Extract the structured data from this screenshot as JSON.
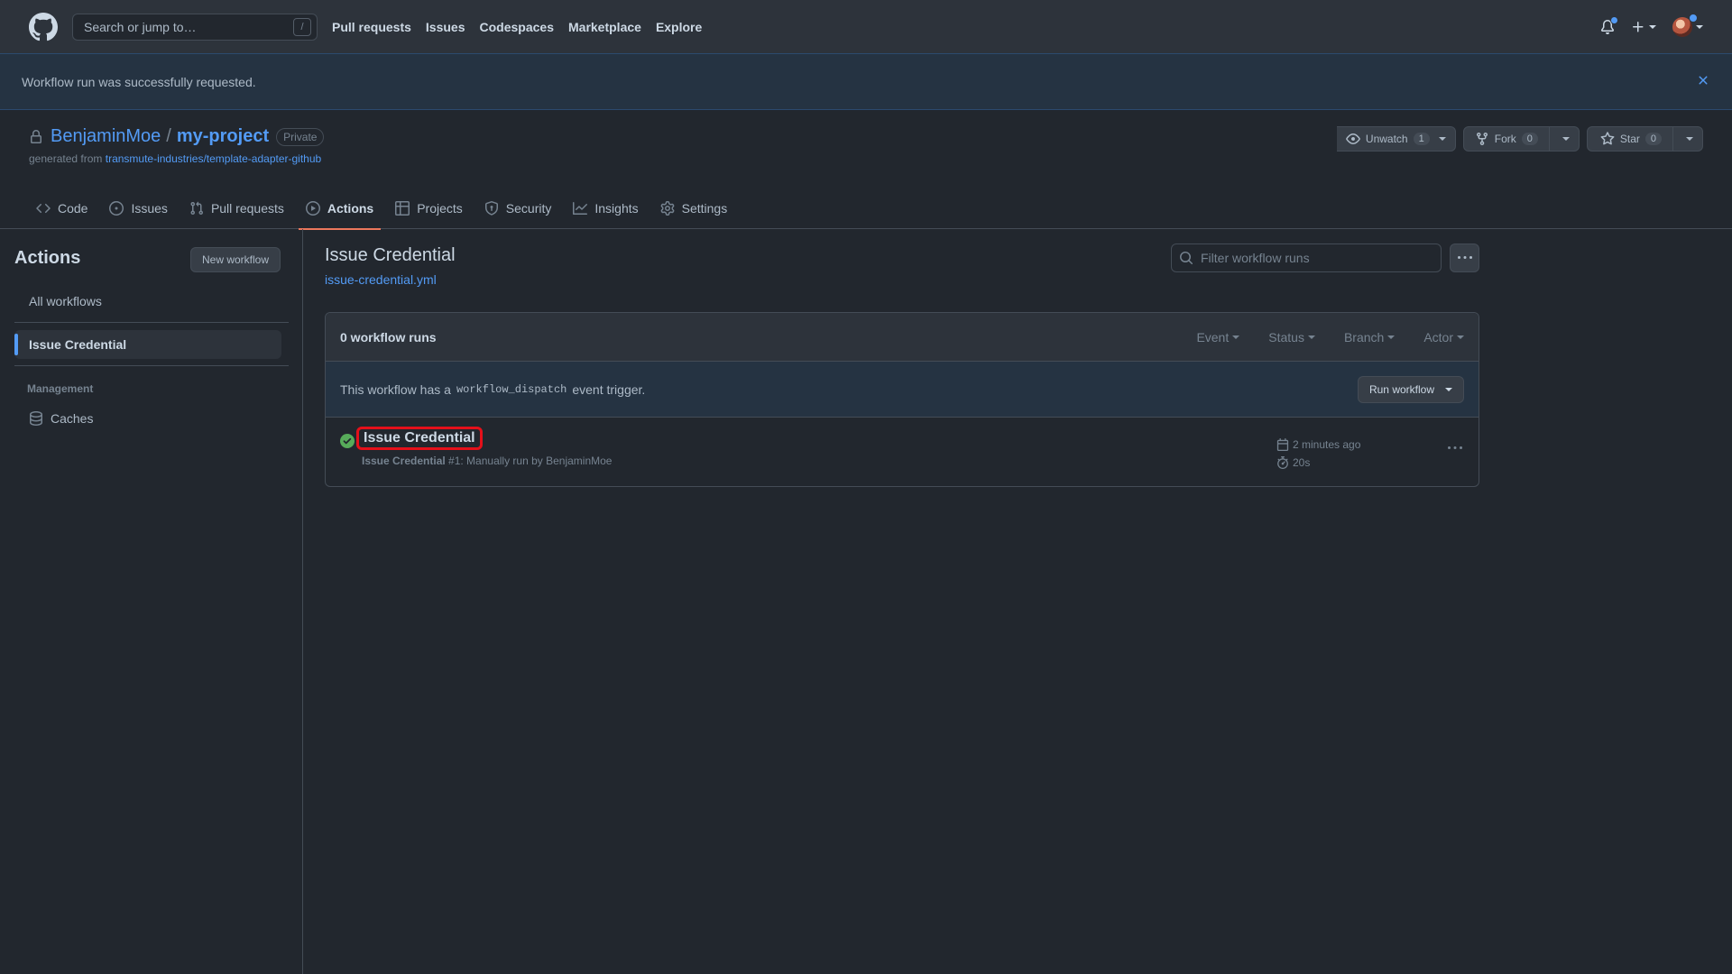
{
  "header": {
    "search_placeholder": "Search or jump to…",
    "search_key": "/",
    "nav": [
      "Pull requests",
      "Issues",
      "Codespaces",
      "Marketplace",
      "Explore"
    ]
  },
  "flash": {
    "message": "Workflow run was successfully requested."
  },
  "repo": {
    "owner": "BenjaminMoe",
    "separator": "/",
    "name": "my-project",
    "visibility": "Private",
    "generated_prefix": "generated from",
    "generated_link": "transmute-industries/template-adapter-github",
    "unwatch_label": "Unwatch",
    "unwatch_count": "1",
    "fork_label": "Fork",
    "fork_count": "0",
    "star_label": "Star",
    "star_count": "0"
  },
  "tabs": [
    {
      "label": "Code",
      "icon": "code-icon"
    },
    {
      "label": "Issues",
      "icon": "issue-icon"
    },
    {
      "label": "Pull requests",
      "icon": "pull-request-icon"
    },
    {
      "label": "Actions",
      "icon": "play-icon",
      "selected": true
    },
    {
      "label": "Projects",
      "icon": "table-icon"
    },
    {
      "label": "Security",
      "icon": "shield-icon"
    },
    {
      "label": "Insights",
      "icon": "graph-icon"
    },
    {
      "label": "Settings",
      "icon": "gear-icon"
    }
  ],
  "sidebar": {
    "title": "Actions",
    "new_workflow": "New workflow",
    "all_workflows": "All workflows",
    "selected_workflow": "Issue Credential",
    "management_heading": "Management",
    "caches": "Caches"
  },
  "main": {
    "title": "Issue Credential",
    "file": "issue-credential.yml",
    "filter_placeholder": "Filter workflow runs",
    "runs_count": "0 workflow runs",
    "filters": [
      "Event",
      "Status",
      "Branch",
      "Actor"
    ],
    "dispatch_prefix": "This workflow has a",
    "dispatch_code": "workflow_dispatch",
    "dispatch_suffix": "event trigger.",
    "run_workflow": "Run workflow",
    "run": {
      "title": "Issue Credential",
      "meta_name": "Issue Credential",
      "meta_rest": " #1: Manually run by BenjaminMoe",
      "time_ago": "2 minutes ago",
      "duration": "20s",
      "status": "success"
    }
  },
  "colors": {
    "accent": "#539bf5",
    "selected_tab_underline": "#ec775c",
    "success": "#57ab5a",
    "highlight_box": "#e5101a"
  }
}
